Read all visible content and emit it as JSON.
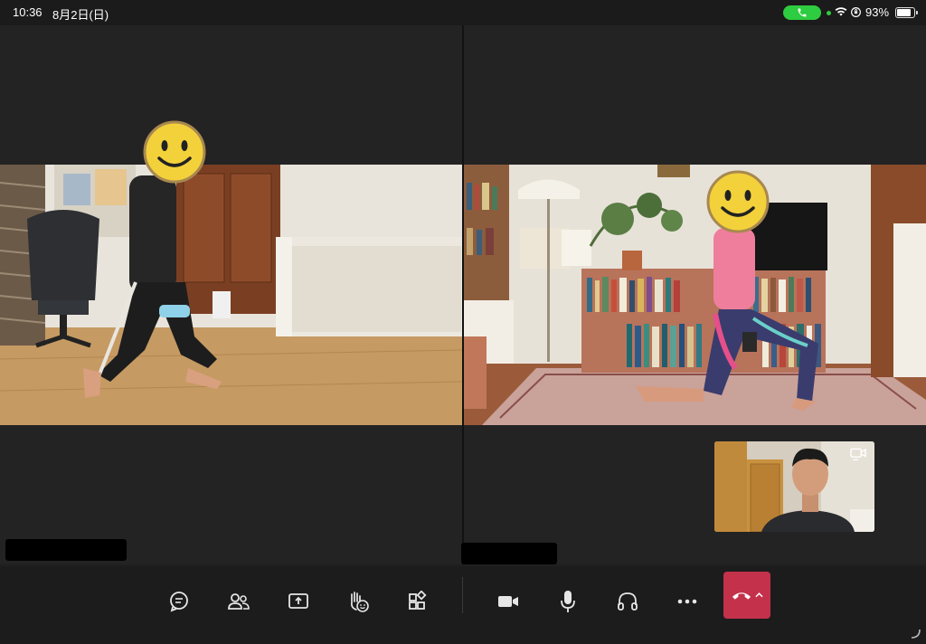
{
  "status_bar": {
    "time": "10:36",
    "date": "8月2日(日)",
    "battery_percent": "93%",
    "battery_level": 0.93
  },
  "participants": [
    {
      "name": "",
      "position": "left"
    },
    {
      "name": "",
      "position": "right"
    }
  ],
  "toolbar": {
    "buttons": [
      {
        "name": "chat",
        "icon": "chat-icon"
      },
      {
        "name": "people",
        "icon": "people-icon"
      },
      {
        "name": "share",
        "icon": "share-screen-icon"
      },
      {
        "name": "reactions",
        "icon": "raise-hand-icon"
      },
      {
        "name": "apps",
        "icon": "apps-icon"
      },
      {
        "name": "camera",
        "icon": "camera-icon"
      },
      {
        "name": "mic",
        "icon": "mic-icon"
      },
      {
        "name": "audio",
        "icon": "headphones-icon"
      },
      {
        "name": "more",
        "icon": "more-icon"
      },
      {
        "name": "hangup",
        "icon": "hangup-icon"
      }
    ]
  },
  "colors": {
    "background": "#1f1f1f",
    "hangup": "#c4314b",
    "call_pill": "#2ecc40"
  }
}
